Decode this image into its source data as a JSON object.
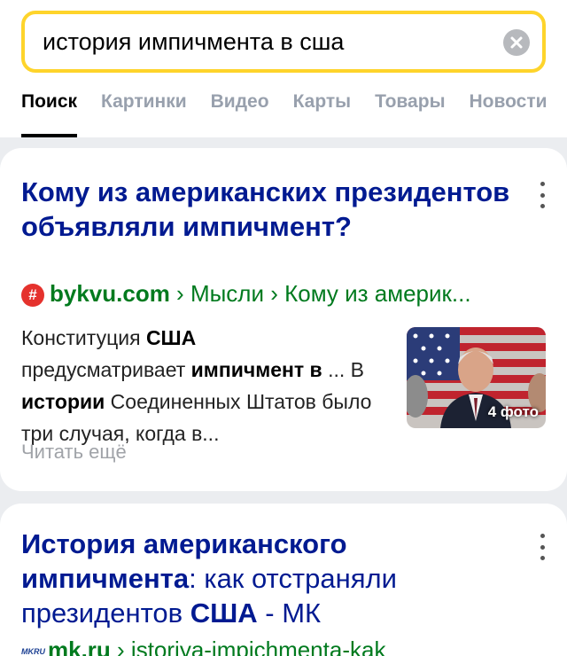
{
  "search": {
    "query": "история импичмента в сша"
  },
  "tabs": [
    {
      "label": "Поиск",
      "active": true
    },
    {
      "label": "Картинки",
      "active": false
    },
    {
      "label": "Видео",
      "active": false
    },
    {
      "label": "Карты",
      "active": false
    },
    {
      "label": "Товары",
      "active": false
    },
    {
      "label": "Новости",
      "active": false
    }
  ],
  "results": [
    {
      "title": "Кому из американских президентов объявляли импичмент?",
      "favicon": "#",
      "domain": "bykvu.com",
      "breadcrumb_1": "Мысли",
      "breadcrumb_2": "Кому из америк...",
      "snippet": {
        "t1": "Конституция ",
        "b1": "США",
        "t2": " предусматривает ",
        "b2": "импичмент в",
        "t3": " ... В ",
        "b3": "истории",
        "t4": " Соединенных Штатов было три случая, когда в..."
      },
      "read_more": "Читать ещё",
      "photo_count": "4 фото"
    },
    {
      "title_part1": "История американского импичмента",
      "title_part2": ": как отстраняли президентов ",
      "title_part3": "США",
      "title_part4": " - МК",
      "favicon": "MKRU",
      "domain": "mk.ru",
      "breadcrumb_1": "istoriya-impichmenta-kak"
    }
  ],
  "colors": {
    "search_border": "#fed42b",
    "link": "#001a91",
    "url": "#007a1e",
    "tab_inactive": "#98a0ad"
  }
}
